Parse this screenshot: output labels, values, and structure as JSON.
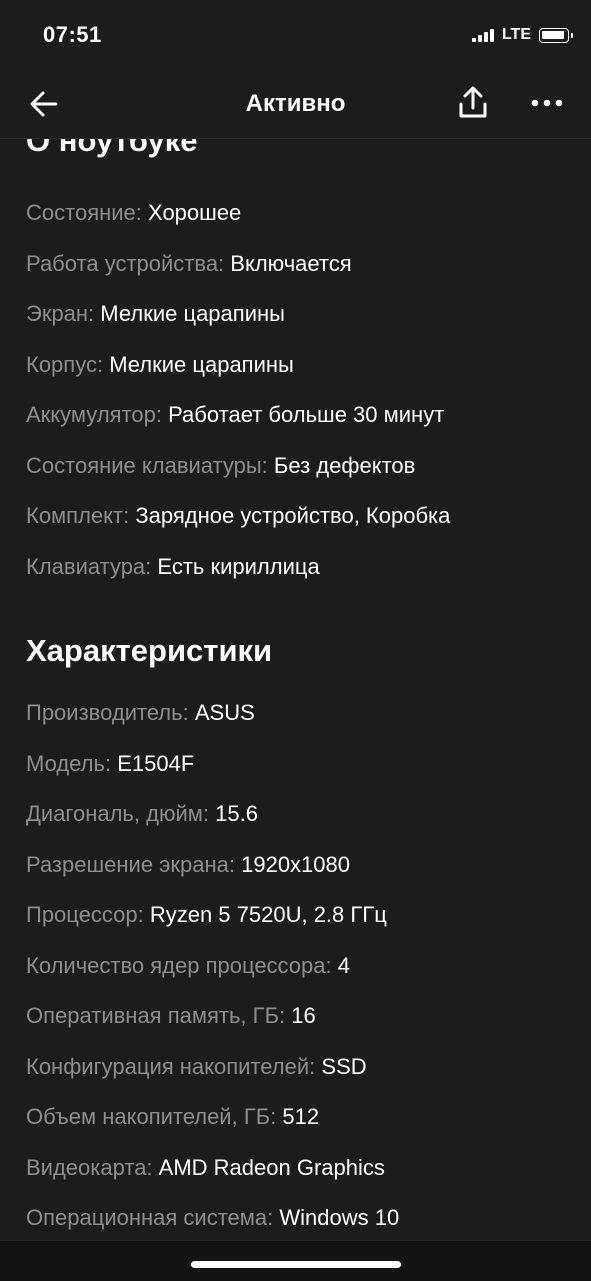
{
  "status_bar": {
    "time": "07:51",
    "network": "LTE"
  },
  "nav": {
    "title": "Активно",
    "back_icon": "arrow-left-icon",
    "share_icon": "share-icon",
    "more_icon": "more-dots-icon"
  },
  "about": {
    "heading": "О ноутбуке",
    "rows": [
      {
        "label": "Состояние:",
        "value": "Хорошее"
      },
      {
        "label": "Работа устройства:",
        "value": "Включается"
      },
      {
        "label": "Экран:",
        "value": "Мелкие царапины"
      },
      {
        "label": "Корпус:",
        "value": "Мелкие царапины"
      },
      {
        "label": "Аккумулятор:",
        "value": "Работает больше 30 минут"
      },
      {
        "label": "Состояние клавиатуры:",
        "value": "Без дефектов"
      },
      {
        "label": "Комплект:",
        "value": "Зарядное устройство, Коробка"
      },
      {
        "label": "Клавиатура:",
        "value": "Есть кириллица"
      }
    ]
  },
  "specs": {
    "heading": "Характеристики",
    "rows": [
      {
        "label": "Производитель:",
        "value": "ASUS"
      },
      {
        "label": "Модель:",
        "value": "E1504F"
      },
      {
        "label": "Диагональ, дюйм:",
        "value": "15.6"
      },
      {
        "label": "Разрешение экрана:",
        "value": "1920x1080"
      },
      {
        "label": "Процессор:",
        "value": "Ryzen 5 7520U, 2.8 ГГц"
      },
      {
        "label": "Количество ядер процессора:",
        "value": "4"
      },
      {
        "label": "Оперативная память, ГБ:",
        "value": "16"
      },
      {
        "label": "Конфигурация накопителей:",
        "value": "SSD"
      },
      {
        "label": "Объем накопителей, ГБ:",
        "value": "512"
      },
      {
        "label": "Видеокарта:",
        "value": "AMD Radeon Graphics"
      },
      {
        "label": "Операционная система:",
        "value": "Windows 10"
      }
    ]
  },
  "colors": {
    "background": "#1c1c1c",
    "label": "#8d8d8d",
    "value": "#ffffff"
  }
}
